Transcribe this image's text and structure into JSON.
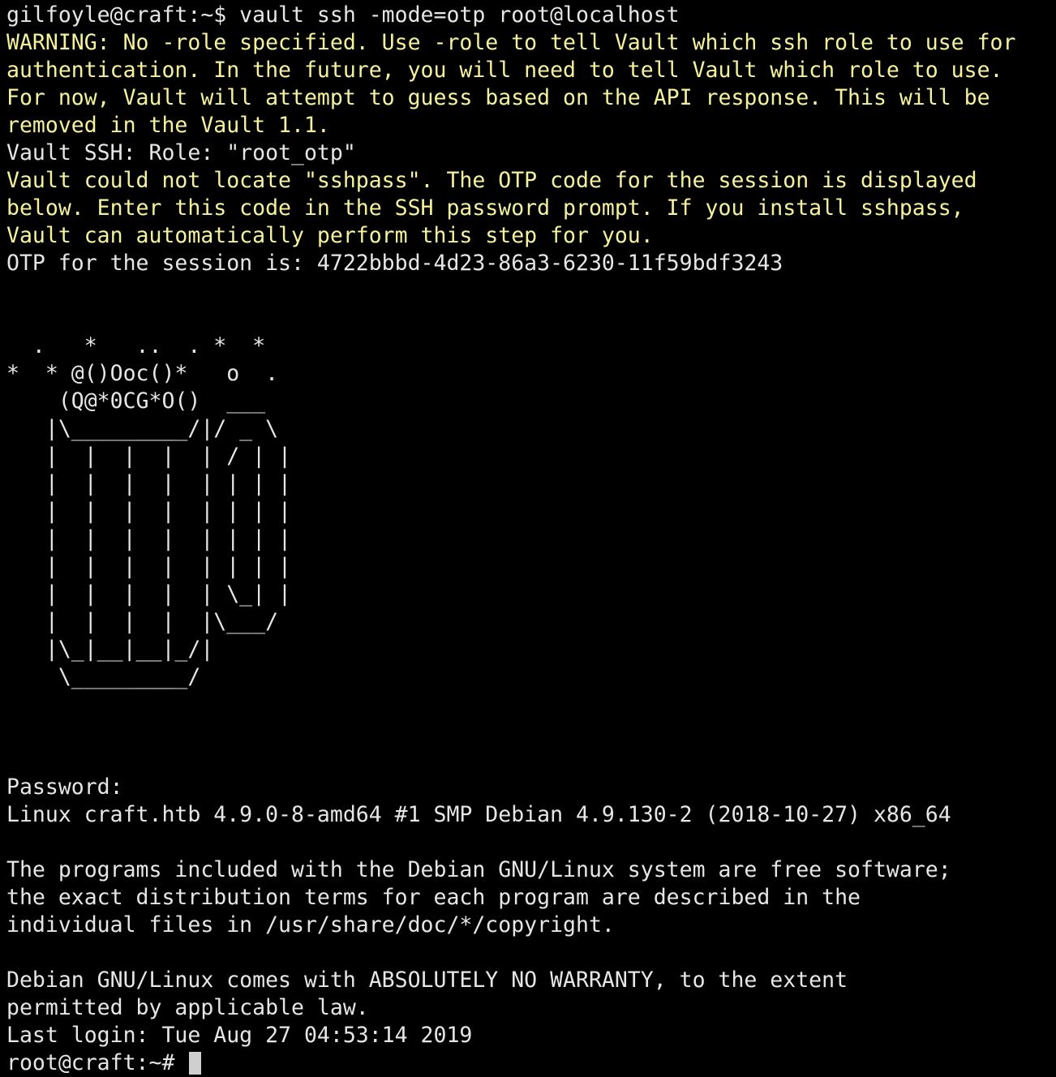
{
  "terminal": {
    "prompt_line": "gilfoyle@craft:~$ vault ssh -mode=otp root@localhost",
    "warning_lines": [
      "WARNING: No -role specified. Use -role to tell Vault which ssh role to use for",
      "authentication. In the future, you will need to tell Vault which role to use.",
      "For now, Vault will attempt to guess based on the API response. This will be",
      "removed in the Vault 1.1."
    ],
    "role_line": "Vault SSH: Role: \"root_otp\"",
    "sshpass_lines": [
      "Vault could not locate \"sshpass\". The OTP code for the session is displayed",
      "below. Enter this code in the SSH password prompt. If you install sshpass,",
      "Vault can automatically perform this step for you."
    ],
    "otp_line": "OTP for the session is: 4722bbbd-4d23-86a3-6230-11f59bdf3243",
    "ascii_art": [
      "  .   *   ..  . *  *",
      "*  * @()Ooc()*   o  .",
      "    (Q@*0CG*O()  ___",
      "   |\\_________/|/ _ \\",
      "   |  |  |  |  | / | |",
      "   |  |  |  |  | | | |",
      "   |  |  |  |  | | | |",
      "   |  |  |  |  | | | |",
      "   |  |  |  |  | | | |",
      "   |  |  |  |  | \\_| |",
      "   |  |  |  |  |\\___/",
      "   |\\_|__|__|_/|",
      "    \\_________/"
    ],
    "password_prompt": "Password:",
    "kernel_line": "Linux craft.htb 4.9.0-8-amd64 #1 SMP Debian 4.9.130-2 (2018-10-27) x86_64",
    "motd_lines": [
      "The programs included with the Debian GNU/Linux system are free software;",
      "the exact distribution terms for each program are described in the",
      "individual files in /usr/share/doc/*/copyright."
    ],
    "warranty_lines": [
      "Debian GNU/Linux comes with ABSOLUTELY NO WARRANTY, to the extent",
      "permitted by applicable law."
    ],
    "last_login": "Last login: Tue Aug 27 04:53:14 2019",
    "root_prompt": "root@craft:~# "
  },
  "colors": {
    "background": "#000000",
    "text": "#e6e6e6",
    "warning": "#f5f29b"
  }
}
